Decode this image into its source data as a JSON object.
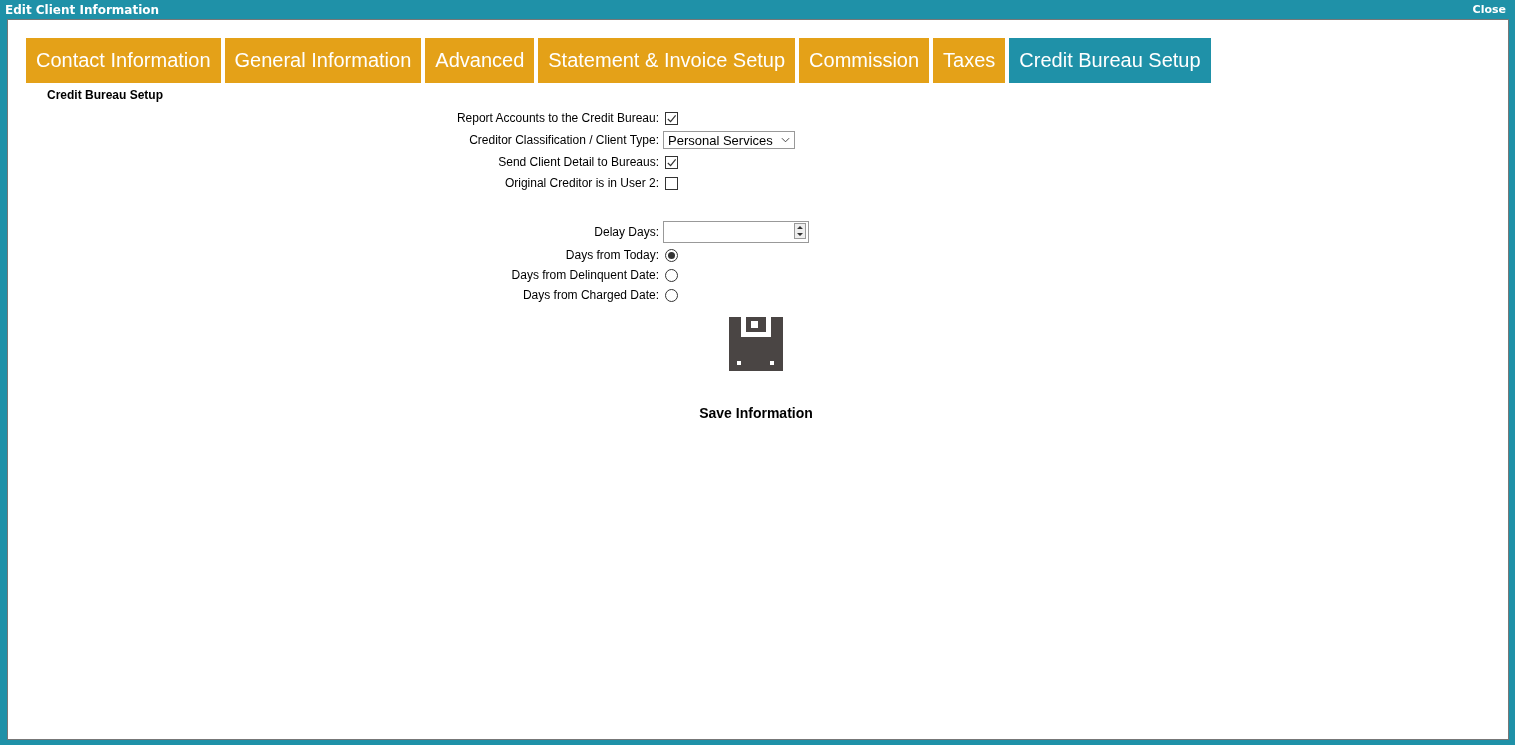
{
  "window": {
    "title": "Edit Client Information",
    "close": "Close"
  },
  "tabs": [
    {
      "label": "Contact Information",
      "selected": false
    },
    {
      "label": "General Information",
      "selected": false
    },
    {
      "label": "Advanced",
      "selected": false
    },
    {
      "label": "Statement & Invoice Setup",
      "selected": false
    },
    {
      "label": "Commission",
      "selected": false
    },
    {
      "label": "Taxes",
      "selected": false
    },
    {
      "label": "Credit Bureau Setup",
      "selected": true
    }
  ],
  "section_title": "Credit Bureau Setup",
  "settings": [
    {
      "kind": "checkbox",
      "label": "Report Accounts to the Credit Bureau:",
      "checked": true
    },
    {
      "kind": "select",
      "label": "Creditor Classification / Client Type:",
      "value": "Personal Services"
    },
    {
      "kind": "checkbox",
      "label": "Send Client Detail to Bureaus:",
      "checked": true
    },
    {
      "kind": "checkbox",
      "label": "Original Creditor is in User 2:",
      "checked": false
    }
  ],
  "delay": [
    {
      "kind": "spinner",
      "label": "Delay Days:"
    },
    {
      "kind": "radio",
      "label": "Days from Today:",
      "selected": true
    },
    {
      "kind": "radio",
      "label": "Days from Delinquent Date:",
      "selected": false
    },
    {
      "kind": "radio",
      "label": "Days from Charged Date:",
      "selected": false
    }
  ],
  "save_button": "Save Information"
}
